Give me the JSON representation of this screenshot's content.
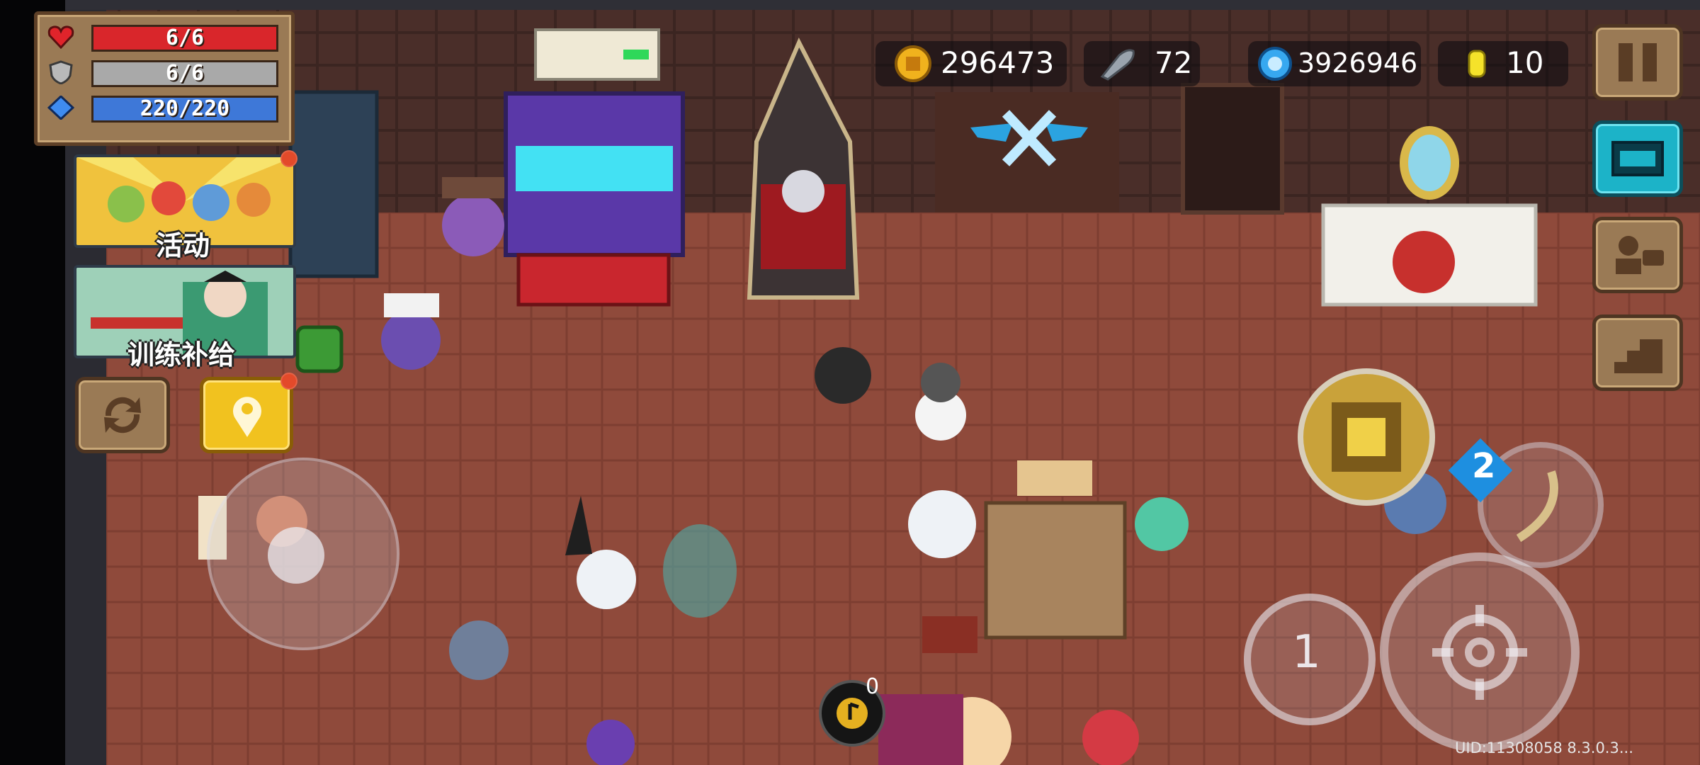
{
  "stats": {
    "hp": {
      "text": "6/6",
      "fraction": 1.0,
      "color": "#d9262b"
    },
    "armor": {
      "text": "6/6",
      "fraction": 1.0,
      "color": "#a9a9a9"
    },
    "energy": {
      "text": "220/220",
      "fraction": 1.0,
      "color": "#3e78d8"
    }
  },
  "resources": {
    "gold": "296473",
    "fish": "72",
    "gems": "3926946",
    "coins": "10"
  },
  "menu": {
    "activity_label": "活动",
    "training_label": "训练补给"
  },
  "controls": {
    "skill_count": "1",
    "weapon_badge": "2",
    "music_badge": "0"
  },
  "footer": {
    "uid": "UID:11308058 8.3.0.3..."
  },
  "icons": {
    "heart": "heart-icon",
    "shield": "shield-icon",
    "energy": "energy-icon",
    "gold": "gold-coin-icon",
    "fish": "fish-icon",
    "gem": "gem-icon",
    "coin": "coin-icon",
    "pause": "pause-icon"
  }
}
